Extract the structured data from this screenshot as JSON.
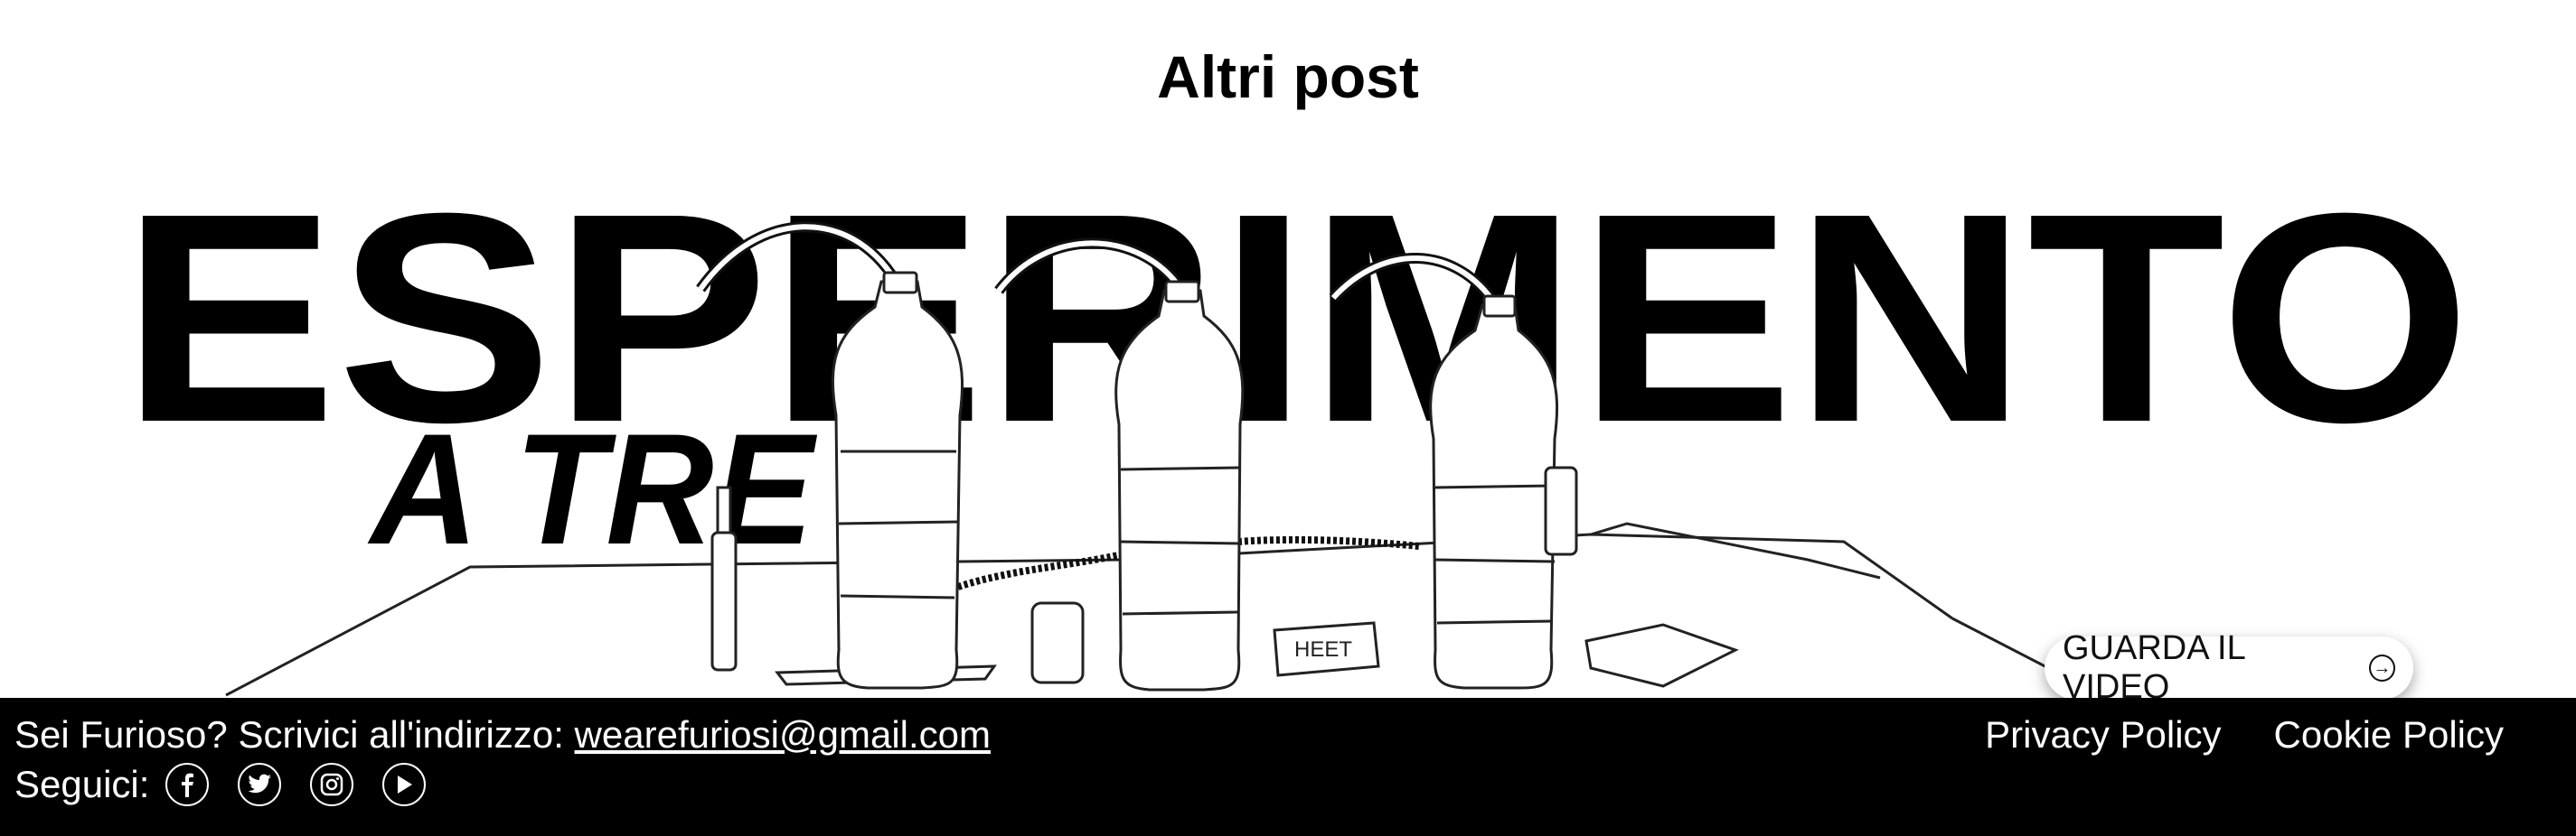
{
  "section": {
    "title": "Altri post"
  },
  "hero": {
    "title_main": "ESPERIMENTO",
    "title_sub": "A TRE",
    "bottle_label": "HEET",
    "cta_label": "GUARDA IL VIDEO",
    "cta_icon": "arrow-right-circle-icon"
  },
  "footer": {
    "contact_prefix": "Sei Furioso? Scrivici all'indirizzo:",
    "contact_email": "wearefuriosi@gmail.com",
    "social_label": "Seguici:",
    "social_icons": [
      "facebook-icon",
      "twitter-icon",
      "instagram-icon",
      "youtube-icon"
    ],
    "privacy_label": "Privacy Policy",
    "cookie_label": "Cookie Policy"
  },
  "colors": {
    "footer_bg": "#000000",
    "text": "#000000",
    "background": "#ffffff"
  }
}
